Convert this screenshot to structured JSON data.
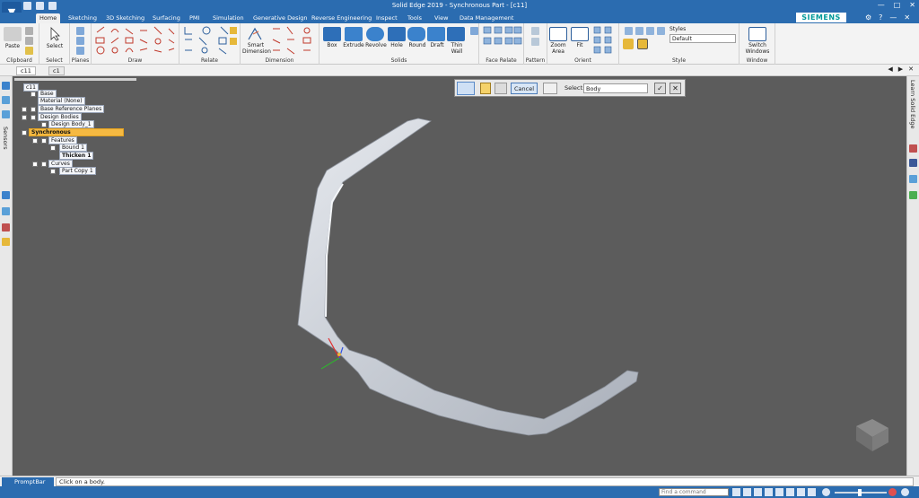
{
  "titlebar": {
    "title": "Solid Edge 2019 - Synchronous Part - [c11]"
  },
  "brand": "SIEMENS",
  "tabs": [
    "Home",
    "Sketching",
    "3D Sketching",
    "Surfacing",
    "PMI",
    "Simulation",
    "Generative Design",
    "Reverse Engineering",
    "Inspect",
    "Tools",
    "View",
    "Data Management"
  ],
  "ribbon": {
    "groups": [
      "Clipboard",
      "Select",
      "Planes",
      "Draw",
      "Relate",
      "Dimension",
      "Solids",
      "Face Relate",
      "Pattern",
      "Orient",
      "Style",
      "Window"
    ],
    "paste": "Paste",
    "select": "Select",
    "smart_dimension": "Smart Dimension",
    "solids": [
      "Box",
      "Extrude",
      "Revolve",
      "Hole",
      "Round",
      "Draft",
      "Thin Wall"
    ],
    "zoom_area": "Zoom Area",
    "fit": "Fit",
    "styles_label": "Styles",
    "style_value": "Default",
    "switch_windows": "Switch Windows"
  },
  "doc_tabs": [
    "c11",
    "c1"
  ],
  "pathfinder": {
    "items": [
      {
        "label": "c11"
      },
      {
        "label": "Base"
      },
      {
        "label": "Material (None)"
      },
      {
        "label": "Base Reference Planes"
      },
      {
        "label": "Design Bodies"
      },
      {
        "label": "Design Body_1"
      },
      {
        "label": "Synchronous"
      },
      {
        "label": "Features"
      },
      {
        "label": "Bound 1"
      },
      {
        "label": "Thicken 1"
      },
      {
        "label": "Curves"
      },
      {
        "label": "Part Copy 1"
      }
    ]
  },
  "command_bar": {
    "cancel": "Cancel",
    "select_label": "Select:",
    "select_value": "Body"
  },
  "left_panel_label": "Sensors",
  "right_panel_label": "Learn Solid Edge",
  "prompt": {
    "label": "PromptBar",
    "text": "Click on a body."
  },
  "status": {
    "find_placeholder": "Find a command"
  },
  "colors": {
    "accent": "#2b6cb0",
    "canvas": "#5c5c5c",
    "sync_highlight": "#f5b942"
  }
}
